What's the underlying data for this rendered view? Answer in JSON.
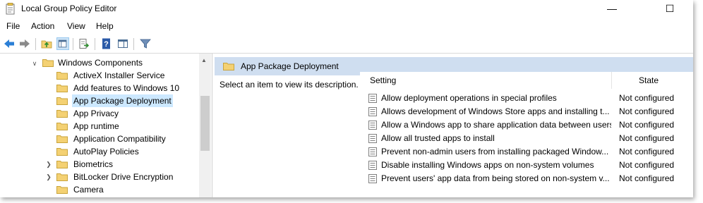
{
  "window": {
    "title": "Local Group Policy Editor",
    "minimize": "—",
    "maximize": "☐"
  },
  "menu": [
    "File",
    "Action",
    "View",
    "Help"
  ],
  "toolbar": {
    "icons": [
      "back-arrow-icon",
      "forward-arrow-icon",
      "up-folder-icon",
      "show-hide-tree-icon",
      "export-list-icon",
      "help-icon",
      "properties-pane-icon",
      "filter-icon"
    ]
  },
  "tree": {
    "items": [
      {
        "label": "Windows Components",
        "expander": "expanded",
        "selected": false
      },
      {
        "label": "ActiveX Installer Service",
        "expander": "none",
        "selected": false
      },
      {
        "label": "Add features to Windows 10",
        "expander": "none",
        "selected": false
      },
      {
        "label": "App Package Deployment",
        "expander": "none",
        "selected": true
      },
      {
        "label": "App Privacy",
        "expander": "none",
        "selected": false
      },
      {
        "label": "App runtime",
        "expander": "none",
        "selected": false
      },
      {
        "label": "Application Compatibility",
        "expander": "none",
        "selected": false
      },
      {
        "label": "AutoPlay Policies",
        "expander": "none",
        "selected": false
      },
      {
        "label": "Biometrics",
        "expander": "collapsed",
        "selected": false
      },
      {
        "label": "BitLocker Drive Encryption",
        "expander": "collapsed",
        "selected": false
      },
      {
        "label": "Camera",
        "expander": "none",
        "selected": false
      }
    ]
  },
  "details": {
    "header_title": "App Package Deployment",
    "description": "Select an item to view its description.",
    "columns": {
      "setting": "Setting",
      "state": "State"
    },
    "rows": [
      {
        "setting": "Allow deployment operations in special profiles",
        "state": "Not configured"
      },
      {
        "setting": "Allows development of Windows Store apps and installing t...",
        "state": "Not configured"
      },
      {
        "setting": "Allow a Windows app to share application data between users",
        "state": "Not configured"
      },
      {
        "setting": "Allow all trusted apps to install",
        "state": "Not configured"
      },
      {
        "setting": "Prevent non-admin users from installing packaged Window...",
        "state": "Not configured"
      },
      {
        "setting": "Disable installing Windows apps on non-system volumes",
        "state": "Not configured"
      },
      {
        "setting": "Prevent users' app data from being stored on non-system v...",
        "state": "Not configured"
      }
    ]
  },
  "colors": {
    "header_bg": "#cfdef0",
    "selection": "#cce8ff",
    "folder": "#f4d173",
    "back_icon": "#2b7fd6"
  }
}
